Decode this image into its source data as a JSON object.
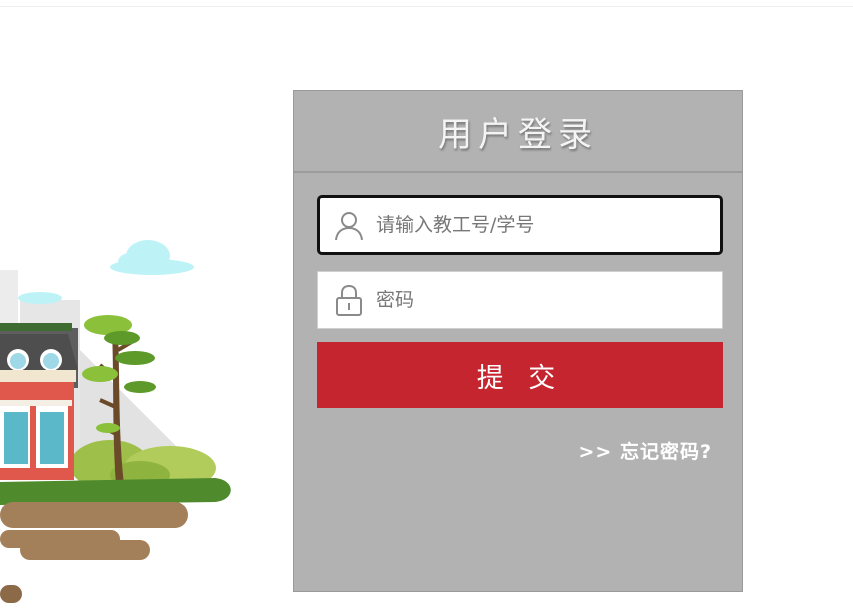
{
  "login": {
    "title": "用户登录",
    "username": {
      "placeholder": "请输入教工号/学号",
      "value": ""
    },
    "password": {
      "placeholder": "密码",
      "value": ""
    },
    "submit_label": "提 交",
    "forgot_label": ">> 忘记密码?"
  },
  "icons": {
    "username": "user-icon",
    "password": "lock-icon"
  },
  "colors": {
    "panel_bg": "#b2b2b2",
    "submit_bg": "#c5252f",
    "text_light": "#ffffff"
  }
}
